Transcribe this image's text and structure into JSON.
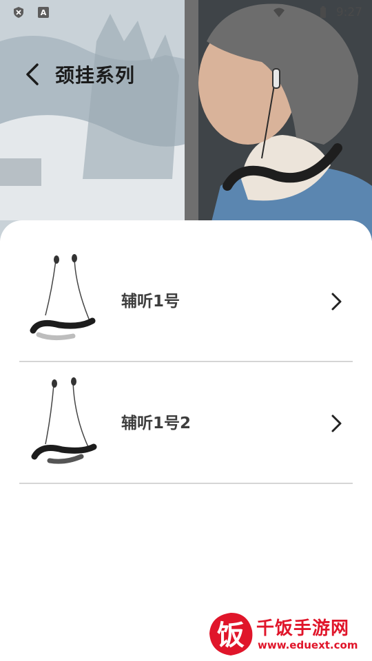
{
  "status_bar": {
    "time": "9:27",
    "icons": [
      "shield-x-icon",
      "keyboard-a-icon",
      "wifi-icon",
      "battery-icon"
    ]
  },
  "header": {
    "title": "颈挂系列",
    "back_icon": "chevron-left-icon"
  },
  "list": {
    "items": [
      {
        "label": "辅听1号",
        "icon": "neckband-earphone-image",
        "chevron": "chevron-right-icon"
      },
      {
        "label": "辅听1号2",
        "icon": "neckband-earphone-image",
        "chevron": "chevron-right-icon"
      }
    ]
  },
  "watermark": {
    "logo_text": "饭",
    "name": "千饭手游网",
    "url": "www.eduext.com"
  },
  "colors": {
    "title_text": "#1b1b1b",
    "item_text": "#3d3d3d",
    "divider": "#d5d5d5",
    "watermark_red": "#e0152a"
  }
}
